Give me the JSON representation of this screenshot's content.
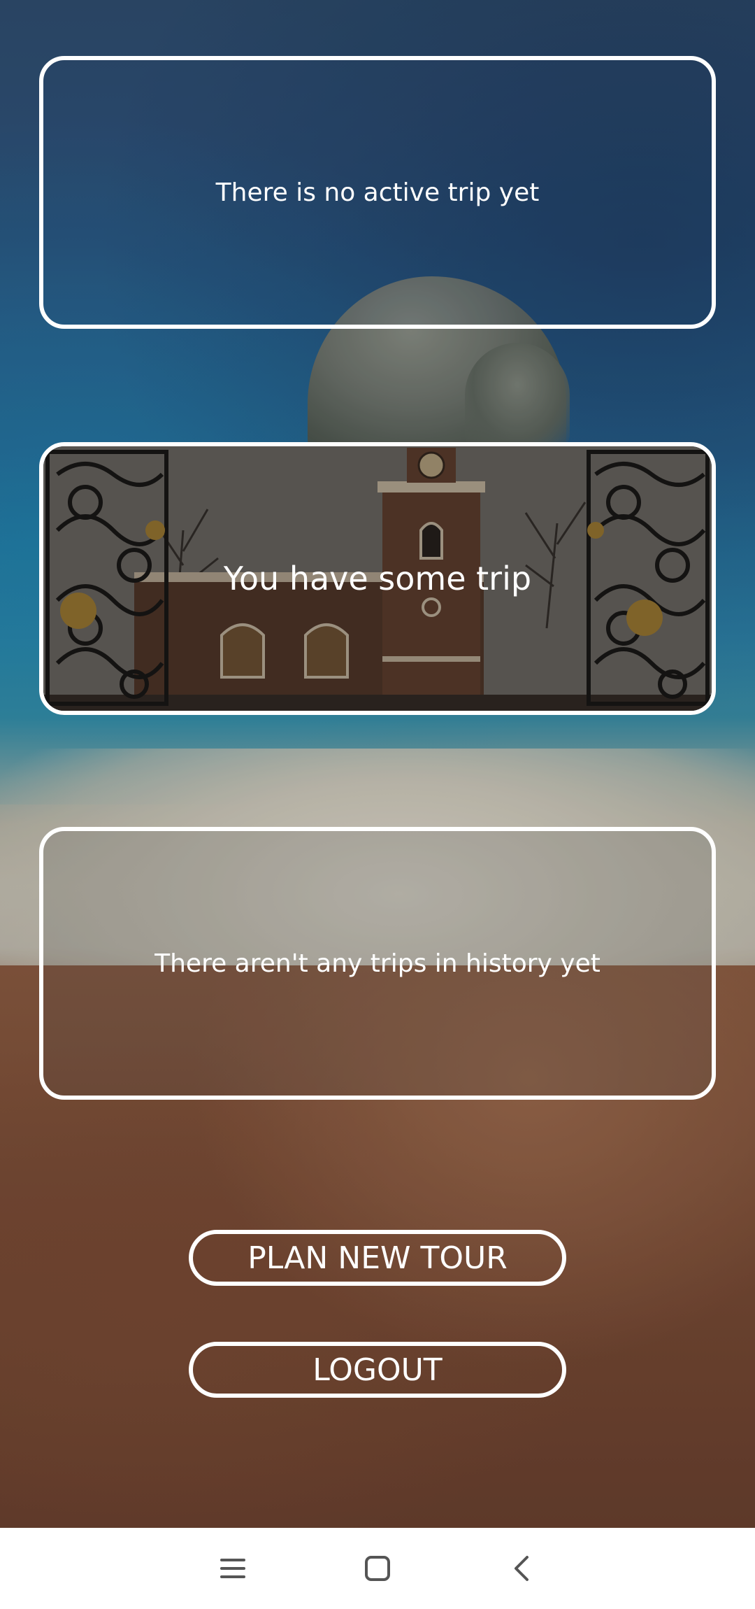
{
  "cards": {
    "active_trip": {
      "message": "There is no active trip yet"
    },
    "trip": {
      "message": "You have some trip"
    },
    "history": {
      "message": "There aren't any trips in history yet"
    }
  },
  "buttons": {
    "plan_new_tour": "PLAN NEW TOUR",
    "logout": "LOGOUT"
  },
  "navbar": {
    "icons": [
      "menu-icon",
      "home-square-icon",
      "back-chevron-icon"
    ]
  },
  "colors": {
    "outline": "#ffffff",
    "navbar_bg": "#ffffff",
    "nav_icon": "#555555"
  }
}
